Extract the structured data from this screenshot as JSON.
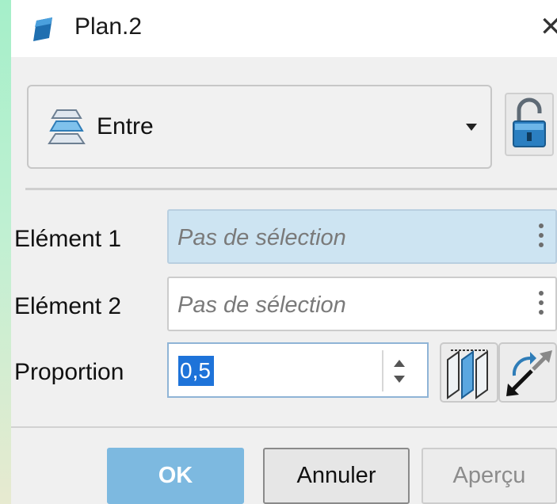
{
  "window": {
    "title": "Plan.2",
    "close_glyph": "✕",
    "icon": "plane-feature-icon"
  },
  "type_combo": {
    "selected_value": "Entre",
    "icon": "between-planes-icon",
    "arrow_icon": "dropdown-arrow-icon"
  },
  "lock_button": {
    "icon": "padlock-open-icon"
  },
  "fields": {
    "element1": {
      "label": "Elément 1",
      "placeholder": "Pas de sélection",
      "active": true
    },
    "element2": {
      "label": "Elément 2",
      "placeholder": "Pas de sélection",
      "active": false
    }
  },
  "proportion": {
    "label": "Proportion",
    "value": "0,5"
  },
  "tools": {
    "middle_plane": {
      "icon": "middle-plane-icon"
    },
    "reverse": {
      "icon": "reverse-direction-icon"
    }
  },
  "buttons": {
    "ok": "OK",
    "cancel": "Annuler",
    "preview": "Aperçu"
  },
  "colors": {
    "accent": "#1e73d9",
    "active_field": "#cde4f2",
    "ok_button": "#7db9e0"
  }
}
